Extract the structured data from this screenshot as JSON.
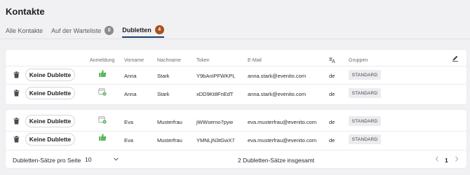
{
  "page": {
    "title": "Kontakte"
  },
  "tabs": [
    {
      "label": "Alle Kontakte"
    },
    {
      "label": "Auf der Warteliste",
      "badge": "0",
      "badge_color": "#8a8a92"
    },
    {
      "label": "Dubletten",
      "badge": "4",
      "badge_color": "#a8521b",
      "active": true
    }
  ],
  "table": {
    "headers": {
      "anmeldung": "Anmeldung",
      "vorname": "Vorname",
      "nachname": "Nachname",
      "token": "Token",
      "email": "E-Mail",
      "language_icon": "translate-icon",
      "gruppen": "Gruppen"
    },
    "groups": [
      {
        "rows": [
          {
            "button": "Keine Dublette",
            "anmeldung_icon": "thumbs-up-icon",
            "vorname": "Anna",
            "nachname": "Stark",
            "token": "Y9bAnIPFWKPL",
            "email": "anna.stark@evenito.com",
            "lang": "de",
            "gruppe": "STANDARD"
          },
          {
            "button": "Keine Dublette",
            "anmeldung_icon": "calendar-check-icon",
            "vorname": "Anna",
            "nachname": "Stark",
            "token": "xDD9Kt8FnEdT",
            "email": "anna.stark@evenito.com",
            "lang": "de",
            "gruppe": "STANDARD"
          }
        ]
      },
      {
        "rows": [
          {
            "button": "Keine Dublette",
            "anmeldung_icon": "calendar-check-icon",
            "vorname": "Eva",
            "nachname": "Musterfrau",
            "token": "jWWserno7pyw",
            "email": "eva.musterfrau@evenito.com",
            "lang": "de",
            "gruppe": "STANDARD"
          },
          {
            "button": "Keine Dublette",
            "anmeldung_icon": "thumbs-up-icon",
            "vorname": "Eva",
            "nachname": "Musterfrau",
            "token": "YMNLjN3tGwX7",
            "email": "eva.musterfrau@evenito.com",
            "lang": "de",
            "gruppe": "STANDARD"
          }
        ]
      }
    ]
  },
  "footer": {
    "per_page_label": "Dubletten-Sätze pro Seite",
    "per_page_value": "10",
    "total_label": "2 Dubletten-Sätze insgesamt",
    "current_page": "1"
  },
  "colors": {
    "accent": "#1b3f6b",
    "success": "#4caf50"
  }
}
